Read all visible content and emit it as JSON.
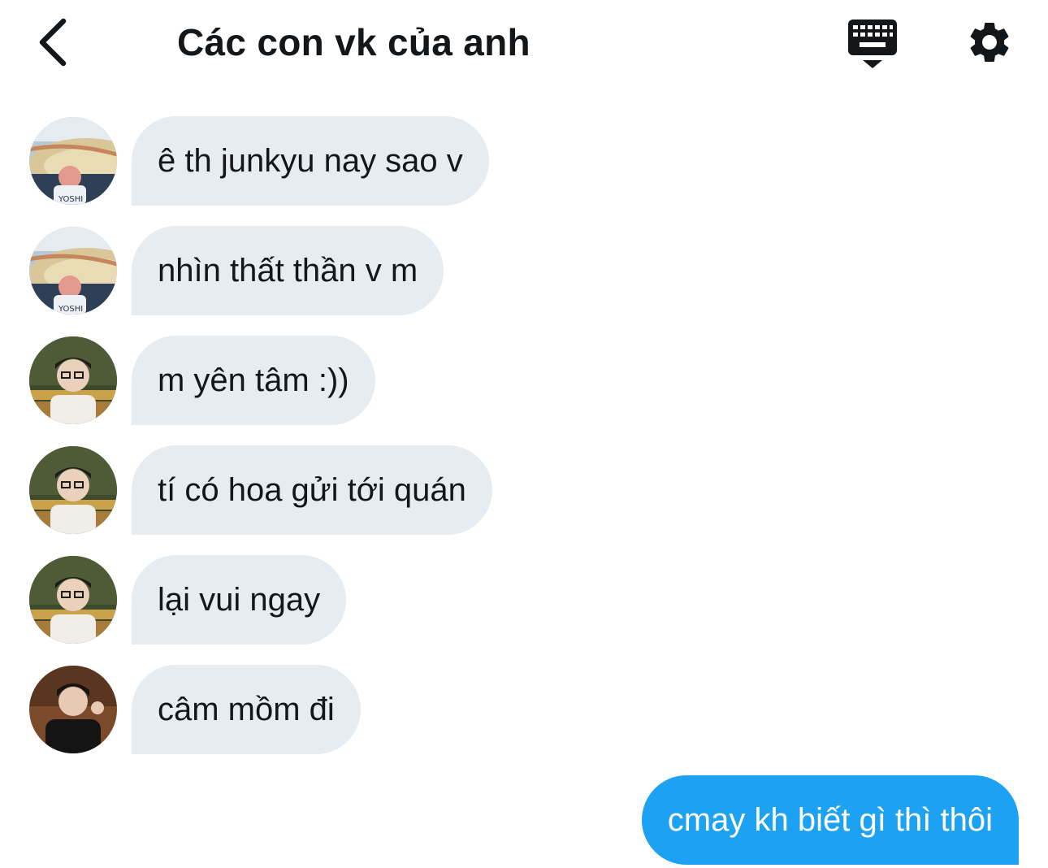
{
  "header": {
    "title": "Các con vk của anh",
    "back_icon": "chevron-left-icon",
    "keyboard_icon": "keyboard-hide-icon",
    "settings_icon": "gear-icon"
  },
  "messages": [
    {
      "text": "ê th junkyu nay sao v",
      "sender": "user-1"
    },
    {
      "text": "nhìn thất thần v m",
      "sender": "user-1"
    },
    {
      "text": "m yên tâm :))",
      "sender": "user-2"
    },
    {
      "text": "tí có hoa gửi tới quán",
      "sender": "user-2"
    },
    {
      "text": "lại vui ngay",
      "sender": "user-2"
    },
    {
      "text": "câm mồm đi",
      "sender": "user-3"
    }
  ],
  "outgoing": {
    "text": "cmay kh biết gì thì thôi"
  },
  "avatar_labels": {
    "user-1": "YOSHI"
  },
  "colors": {
    "incoming_bubble": "#e6ecf0",
    "outgoing_bubble": "#1da1f2",
    "text": "#14171a"
  }
}
